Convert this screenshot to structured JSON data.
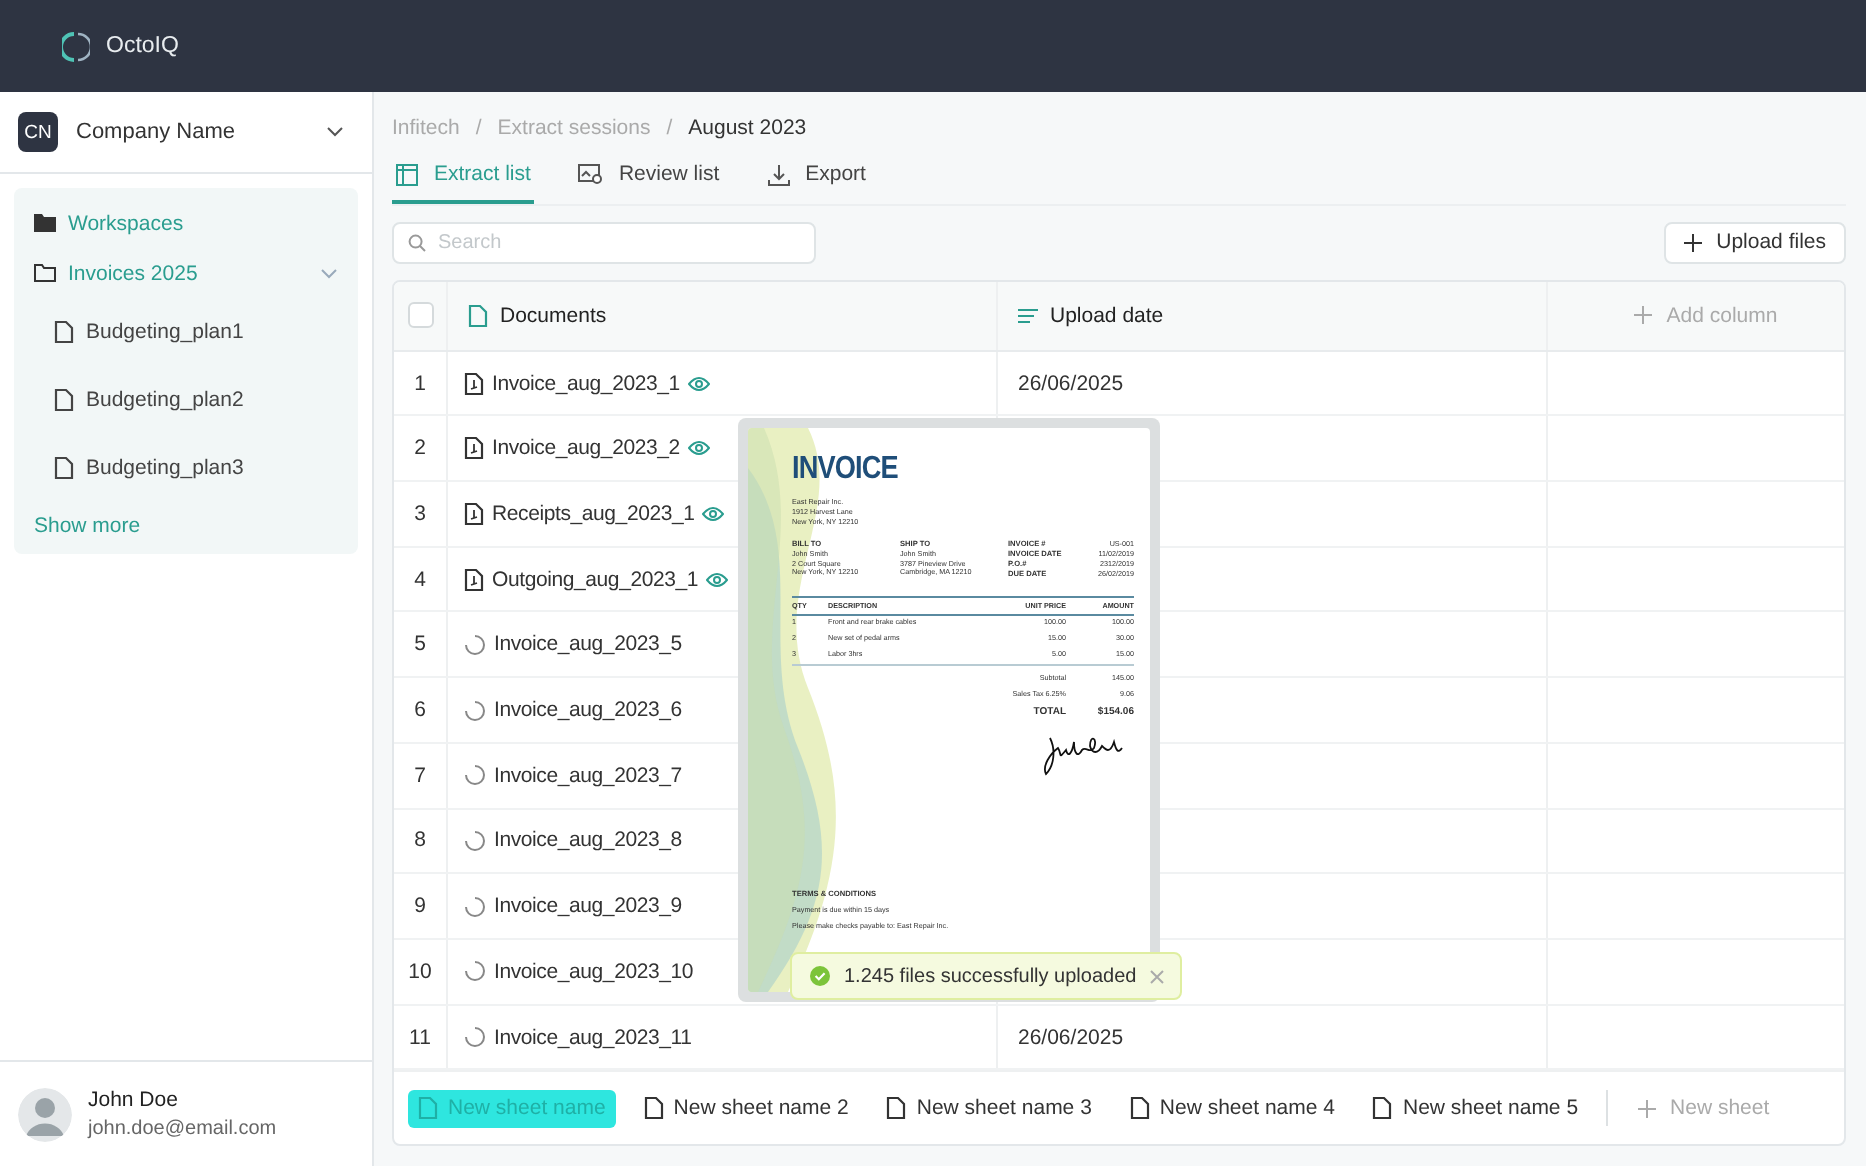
{
  "app": {
    "name": "OctoIQ"
  },
  "company": {
    "initials": "CN",
    "name": "Company Name"
  },
  "nav": {
    "workspaces": "Workspaces",
    "folder": {
      "label": "Invoices 2025",
      "expanded": true,
      "children": [
        {
          "label": "Budgeting_plan1"
        },
        {
          "label": "Budgeting_plan2"
        },
        {
          "label": "Budgeting_plan3"
        }
      ]
    },
    "show_more": "Show more"
  },
  "user": {
    "name": "John Doe",
    "email": "john.doe@email.com"
  },
  "breadcrumb": {
    "separator": "/",
    "items": [
      "Infitech",
      "Extract sessions",
      "August 2023"
    ]
  },
  "tabs": [
    {
      "label": "Extract list",
      "kind": "list",
      "selected": true
    },
    {
      "label": "Review list",
      "kind": "review",
      "selected": false
    },
    {
      "label": "Export",
      "kind": "export",
      "selected": false
    }
  ],
  "search": {
    "placeholder": "Search"
  },
  "upload_button": "Upload files",
  "table": {
    "header_checked": false,
    "columns": [
      "Documents",
      "Upload date"
    ],
    "add_column": "Add column",
    "rows": [
      {
        "index": "1",
        "document": "Invoice_aug_2023_1",
        "kind": "done",
        "upload_date": "26/06/2025"
      },
      {
        "index": "2",
        "document": "Invoice_aug_2023_2",
        "kind": "done"
      },
      {
        "index": "3",
        "document": "Receipts_aug_2023_1",
        "kind": "done"
      },
      {
        "index": "4",
        "document": "Outgoing_aug_2023_1",
        "kind": "done"
      },
      {
        "index": "5",
        "document": "Invoice_aug_2023_5",
        "kind": "processing"
      },
      {
        "index": "6",
        "document": "Invoice_aug_2023_6",
        "kind": "processing"
      },
      {
        "index": "7",
        "document": "Invoice_aug_2023_7",
        "kind": "processing"
      },
      {
        "index": "8",
        "document": "Invoice_aug_2023_8",
        "kind": "processing"
      },
      {
        "index": "9",
        "document": "Invoice_aug_2023_9",
        "kind": "processing"
      },
      {
        "index": "10",
        "document": "Invoice_aug_2023_10",
        "kind": "processing"
      },
      {
        "index": "11",
        "document": "Invoice_aug_2023_11",
        "kind": "processing",
        "upload_date": "26/06/2025"
      }
    ]
  },
  "sheets": [
    {
      "label": "New sheet name",
      "selected": true
    },
    {
      "label": "New sheet name 2",
      "selected": false
    },
    {
      "label": "New sheet name 3",
      "selected": false
    },
    {
      "label": "New sheet name 4",
      "selected": false
    },
    {
      "label": "New sheet name 5",
      "selected": false
    }
  ],
  "new_sheet": "New sheet",
  "toast": {
    "message": "1.245 files successfully uploaded"
  },
  "preview": {
    "title": "INVOICE",
    "from": [
      "East Repair Inc.",
      "1912 Harvest Lane",
      "New York, NY 12210"
    ],
    "bill_to": {
      "heading": "BILL TO",
      "lines": [
        "John Smith",
        "2 Court Square",
        "New York, NY 12210"
      ]
    },
    "ship_to": {
      "heading": "SHIP TO",
      "lines": [
        "John Smith",
        "3787 Pineview Drive",
        "Cambridge, MA 12210"
      ]
    },
    "meta": [
      {
        "label": "INVOICE #",
        "value": "US-001"
      },
      {
        "label": "INVOICE DATE",
        "value": "11/02/2019"
      },
      {
        "label": "P.O.#",
        "value": "2312/2019"
      },
      {
        "label": "DUE DATE",
        "value": "26/02/2019"
      }
    ],
    "columns": [
      "QTY",
      "DESCRIPTION",
      "UNIT PRICE",
      "AMOUNT"
    ],
    "items": [
      {
        "qty": "1",
        "description": "Front and rear brake cables",
        "unit_price": "100.00",
        "amount": "100.00"
      },
      {
        "qty": "2",
        "description": "New set of pedal arms",
        "unit_price": "15.00",
        "amount": "30.00"
      },
      {
        "qty": "3",
        "description": "Labor 3hrs",
        "unit_price": "5.00",
        "amount": "15.00"
      }
    ],
    "totals": [
      {
        "label": "Subtotal",
        "value": "145.00"
      },
      {
        "label": "Sales Tax 6.25%",
        "value": "9.06"
      },
      {
        "label": "TOTAL",
        "value": "$154.06"
      }
    ],
    "terms_heading": "TERMS & CONDITIONS",
    "terms": [
      "Payment is due within 15 days",
      "Please make checks payable to: East Repair Inc."
    ]
  }
}
